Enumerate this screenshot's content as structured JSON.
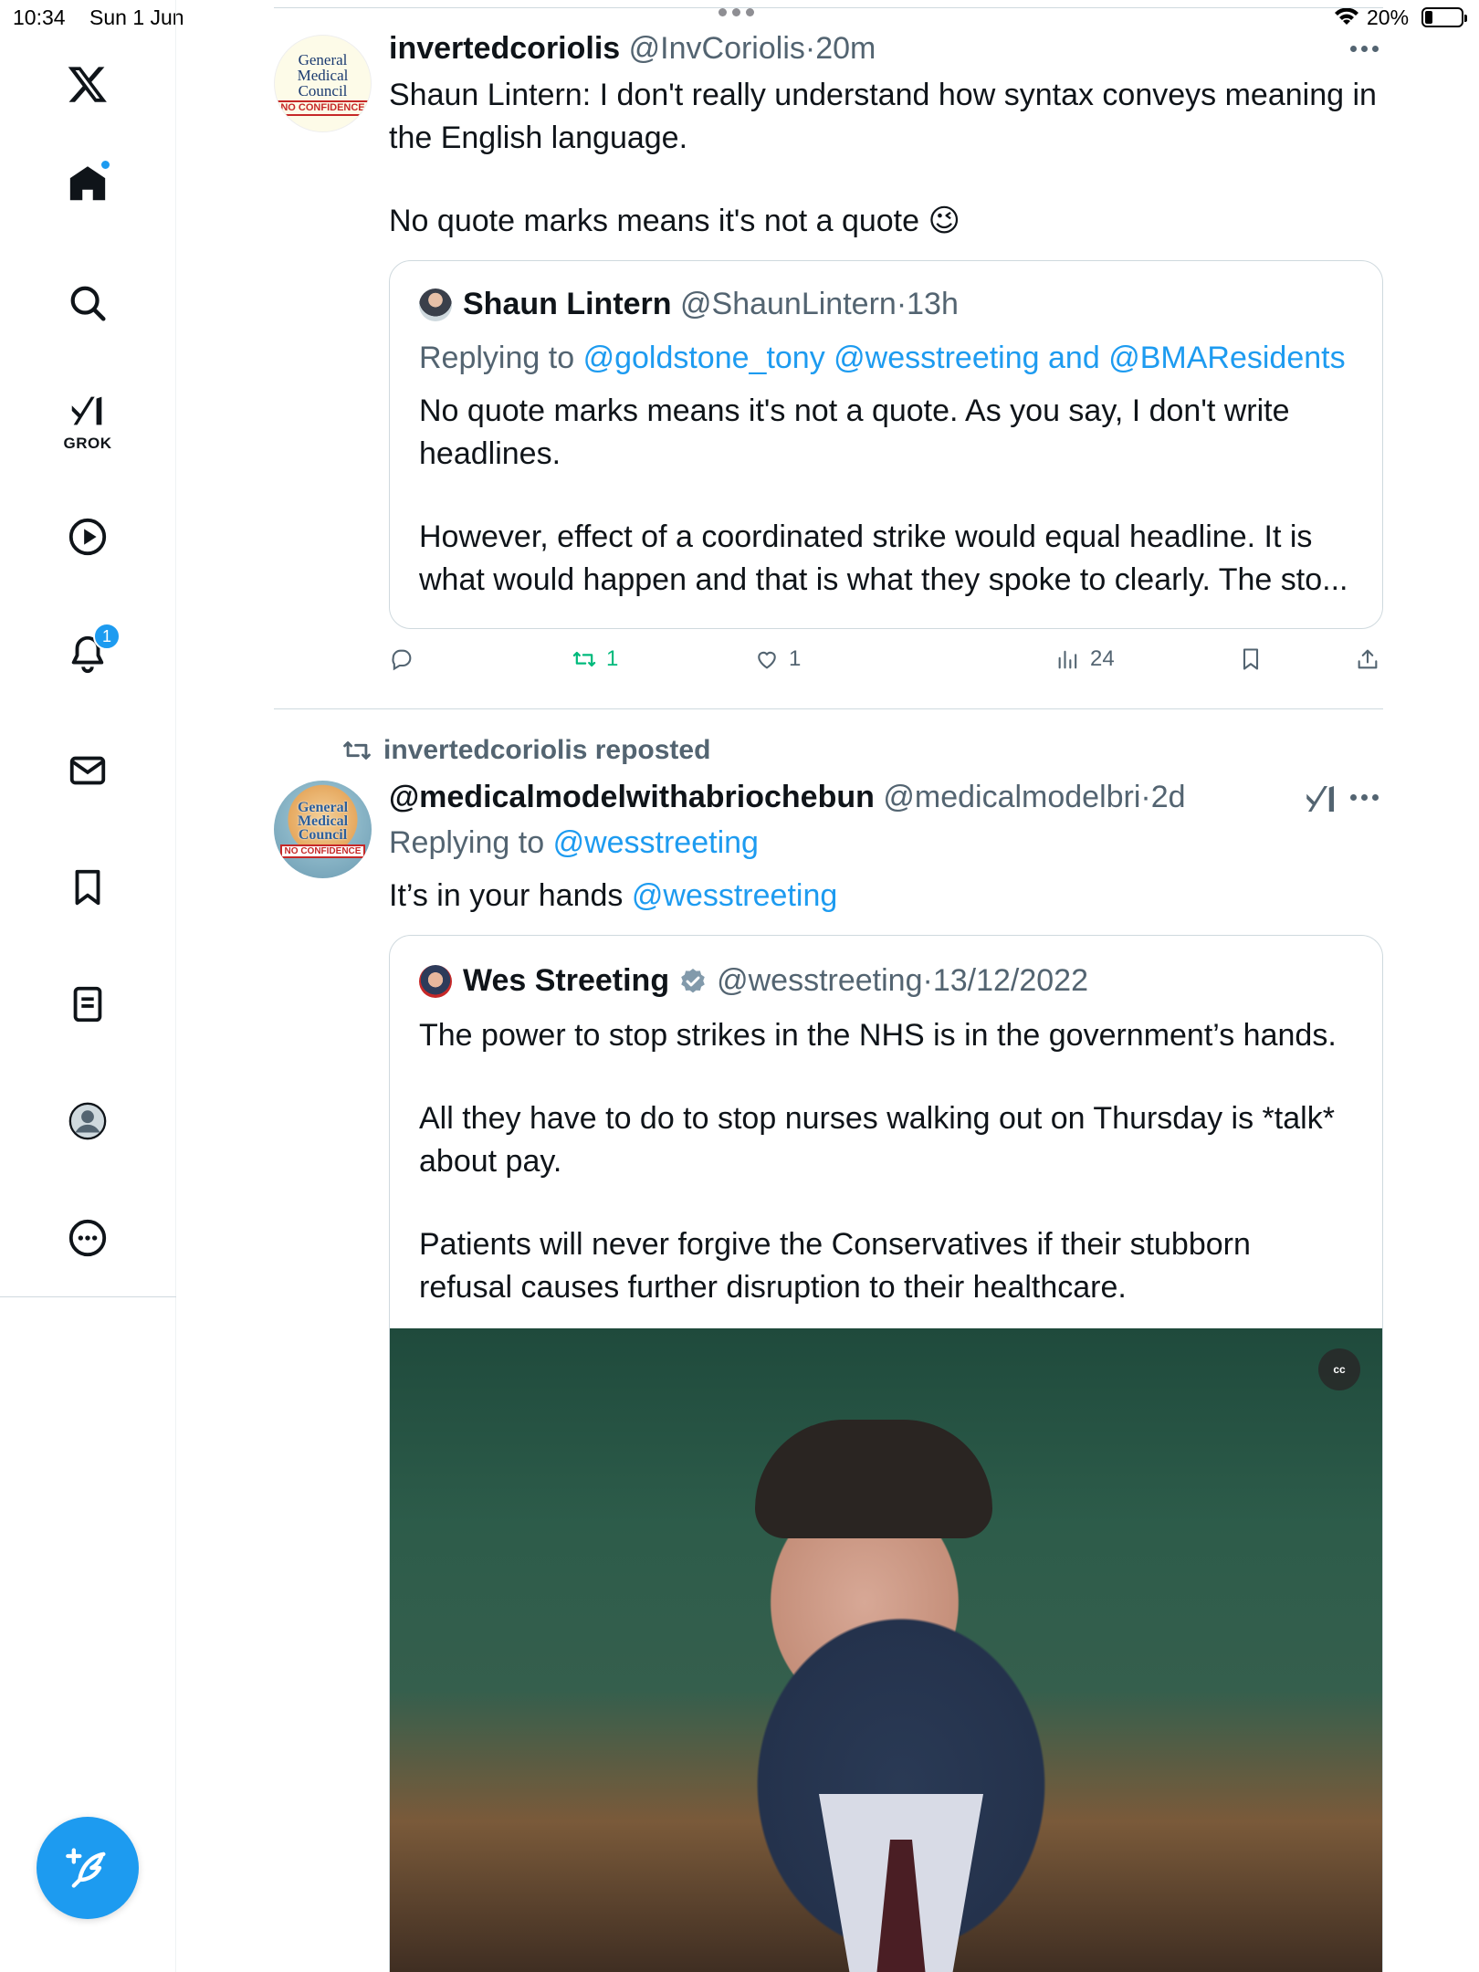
{
  "status_bar": {
    "time": "10:34",
    "date": "Sun 1 Jun",
    "battery": "20%",
    "battery_level": 0.2
  },
  "sidebar": {
    "items": [
      {
        "icon": "x-logo-icon"
      },
      {
        "icon": "home-icon",
        "has_dot": true
      },
      {
        "icon": "search-icon"
      },
      {
        "icon": "grok-icon",
        "label": "GROK"
      },
      {
        "icon": "video-icon"
      },
      {
        "icon": "notifications-icon",
        "badge": "1"
      },
      {
        "icon": "messages-icon"
      },
      {
        "icon": "bookmarks-icon"
      },
      {
        "icon": "lists-icon"
      },
      {
        "icon": "profile-icon"
      },
      {
        "icon": "more-icon"
      }
    ],
    "compose_icon": "compose-icon",
    "accent": "#1d9bf0"
  },
  "posts": [
    {
      "avatar_lines": [
        "General",
        "Medical",
        "Council"
      ],
      "avatar_stamp": "NO CONFIDENCE",
      "name": "invertedcoriolis",
      "handle": "@InvCoriolis",
      "time": "20m",
      "text_line1": "Shaun Lintern: I don't really understand how syntax conveys meaning in the English language.",
      "text_line2": "No quote marks means it's not a quote 😉",
      "quote": {
        "name": "Shaun Lintern",
        "handle": "@ShaunLintern",
        "time": "13h",
        "replying_label": "Replying to",
        "replying_to_1": "@goldstone_tony",
        "replying_to_2": "@wesstreeting",
        "replying_and": "and",
        "replying_to_3": "@BMAResidents",
        "para1": "No quote marks means it's not a quote. As you say, I don't write headlines.",
        "para2": "However, effect of a coordinated strike would equal headline. It is what would happen and that is what they spoke to clearly. The sto..."
      },
      "actions": {
        "replies": "",
        "reposts": "1",
        "likes": "1",
        "views": "24"
      }
    },
    {
      "repost_by": "invertedcoriolis reposted",
      "avatar_lines": [
        "General",
        "Medical",
        "Council"
      ],
      "avatar_stamp": "NO CONFIDENCE",
      "name": "@medicalmodelwithabriochebun",
      "handle": "@medicalmodelbri",
      "time": "2d",
      "replying_label": "Replying to",
      "replying_to": "@wesstreeting",
      "text_plain": "It’s in your hands",
      "text_mention": "@wesstreeting",
      "quote": {
        "name": "Wes Streeting",
        "verified": true,
        "handle": "@wesstreeting",
        "time": "13/12/2022",
        "para1": "The power to stop strikes in the NHS is in the government’s hands.",
        "para2": "All they have to do to stop nurses walking out on Thursday is *talk* about pay.",
        "para3": "Patients will never forgive the Conservatives if their stubborn refusal causes further disruption to their healthcare.",
        "media_caption_badge": "cc"
      }
    }
  ]
}
